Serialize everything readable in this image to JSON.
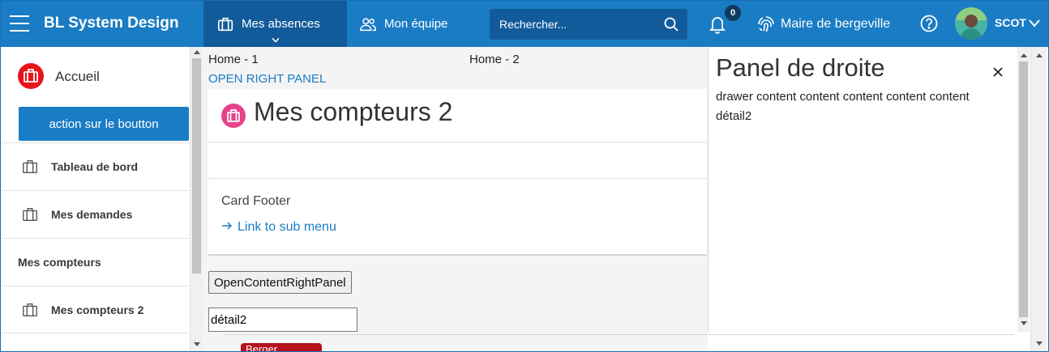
{
  "app": {
    "title": "BL System Design"
  },
  "nav": {
    "tabs": [
      {
        "label": "Mes absences",
        "active": true
      },
      {
        "label": "Mon équipe",
        "active": false
      }
    ]
  },
  "search": {
    "placeholder": "Rechercher..."
  },
  "notifications": {
    "count": "0"
  },
  "org": {
    "label": "Maire de bergeville"
  },
  "user": {
    "name": "SCOT"
  },
  "sidebar": {
    "home_label": "Accueil",
    "action_button": "action sur le boutton",
    "items": [
      {
        "label": "Tableau de bord"
      },
      {
        "label": "Mes demandes"
      }
    ],
    "section_label": "Mes compteurs",
    "sub_items": [
      {
        "label": "Mes compteurs 2"
      }
    ]
  },
  "main": {
    "breadcrumb_1": "Home - 1",
    "breadcrumb_2": "Home - 2",
    "open_right_panel": "OPEN RIGHT PANEL",
    "card": {
      "title": "Mes compteurs 2",
      "footer": "Card Footer",
      "link": "Link to sub menu"
    },
    "open_button": "OpenContentRightPanel",
    "detail_value": "détail2"
  },
  "right_panel": {
    "title": "Panel de droite",
    "content": "drawer content content content content content",
    "detail": "détail2"
  },
  "bottom_chip": {
    "label": "Berger"
  },
  "colors": {
    "primary": "#1a7cc4",
    "primary_dark": "#125b9a",
    "home_icon": "#e8141c",
    "card_icon": "#e6418b"
  }
}
